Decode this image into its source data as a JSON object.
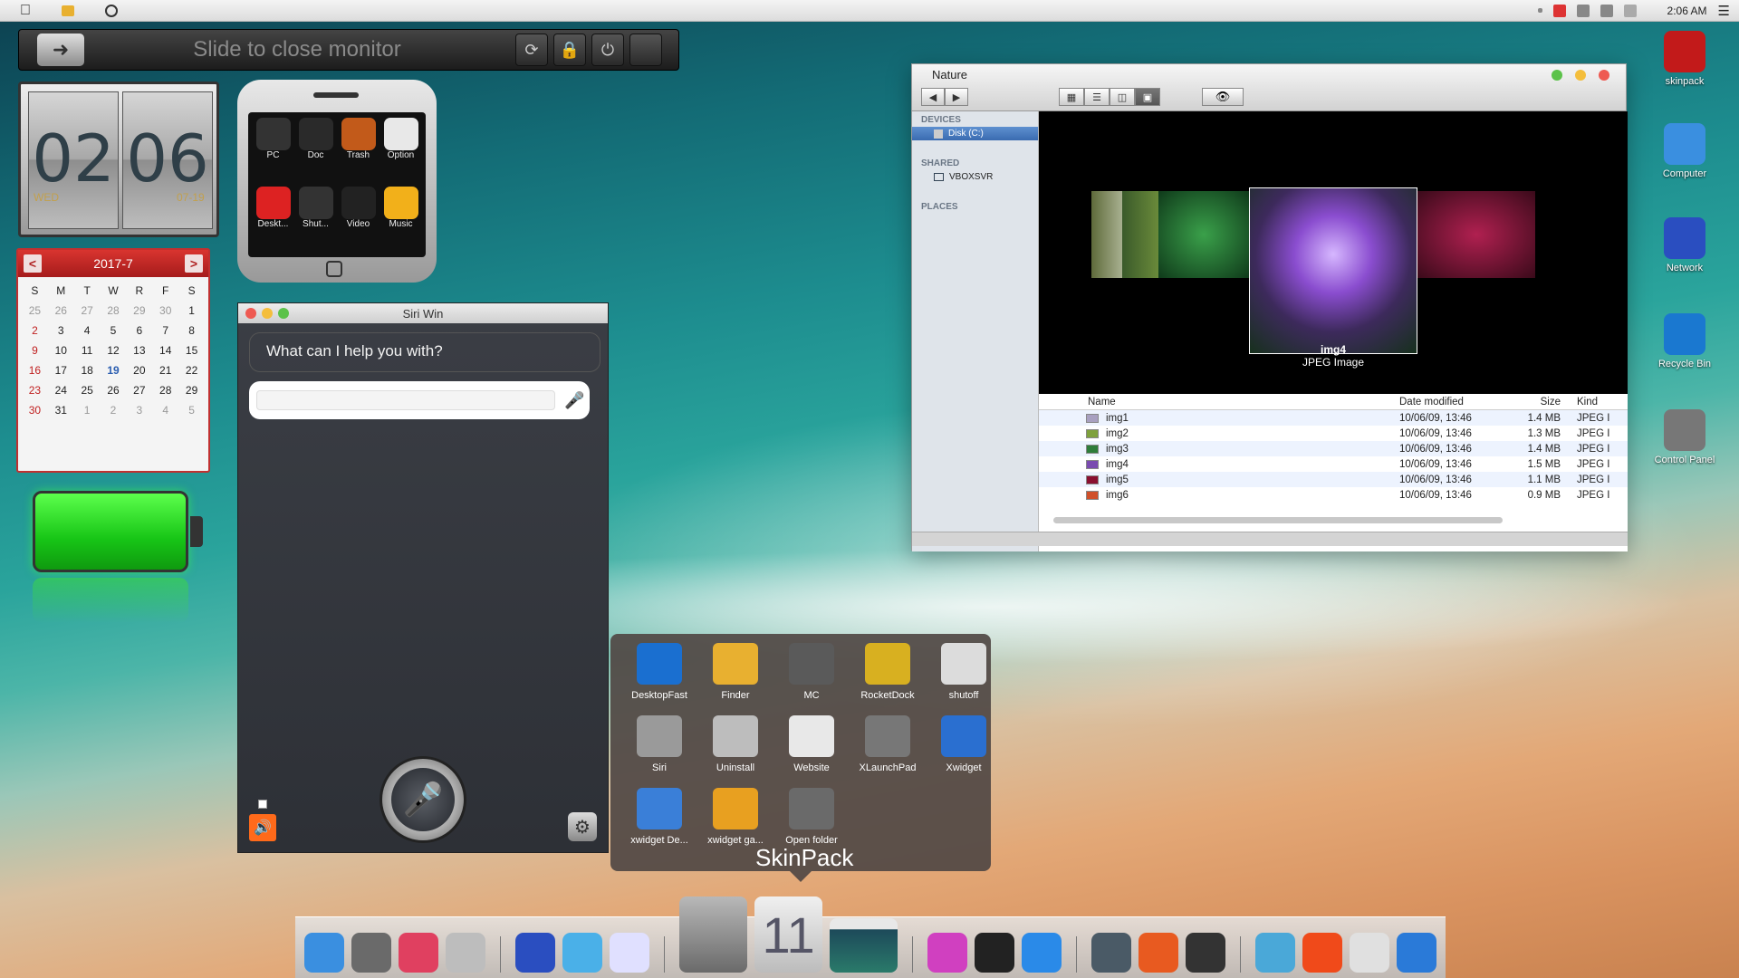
{
  "menubar": {
    "time": "2:06 AM"
  },
  "monitor": {
    "slide_text": "Slide to close monitor"
  },
  "clock": {
    "hour": "02",
    "minute": "06",
    "day": "WED",
    "date": "07-19"
  },
  "calendar": {
    "title": "2017-7",
    "weekdays": [
      "S",
      "M",
      "T",
      "W",
      "R",
      "F",
      "S"
    ],
    "weeks": [
      [
        "25",
        "26",
        "27",
        "28",
        "29",
        "30",
        "1"
      ],
      [
        "2",
        "3",
        "4",
        "5",
        "6",
        "7",
        "8"
      ],
      [
        "9",
        "10",
        "11",
        "12",
        "13",
        "14",
        "15"
      ],
      [
        "16",
        "17",
        "18",
        "19",
        "20",
        "21",
        "22"
      ],
      [
        "23",
        "24",
        "25",
        "26",
        "27",
        "28",
        "29"
      ],
      [
        "30",
        "31",
        "1",
        "2",
        "3",
        "4",
        "5"
      ]
    ]
  },
  "phone": {
    "apps": [
      {
        "label": "PC",
        "color": "#333"
      },
      {
        "label": "Doc",
        "color": "#2a2a2a"
      },
      {
        "label": "Trash",
        "color": "#c25a1a"
      },
      {
        "label": "Option",
        "color": "#e8e8e8"
      },
      {
        "label": "Deskt...",
        "color": "#d22"
      },
      {
        "label": "Shut...",
        "color": "#333"
      },
      {
        "label": "Video",
        "color": "#222"
      },
      {
        "label": "Music",
        "color": "#f2b01a"
      }
    ]
  },
  "siri": {
    "title": "Siri Win",
    "prompt": "What can I help you with?"
  },
  "finder": {
    "title": "Nature",
    "sidebar": {
      "devices_header": "DEVICES",
      "disk": "Disk (C:)",
      "shared_header": "SHARED",
      "shared_item": "VBOXSVR",
      "places_header": "PLACES"
    },
    "preview": {
      "name": "img4",
      "kind": "JPEG Image"
    },
    "columns": {
      "name": "Name",
      "date": "Date modified",
      "size": "Size",
      "kind": "Kind"
    },
    "files": [
      {
        "name": "img1",
        "date": "10/06/09, 13:46",
        "size": "1.4 MB",
        "kind": "JPEG I",
        "color": "#a8a0c0"
      },
      {
        "name": "img2",
        "date": "10/06/09, 13:46",
        "size": "1.3 MB",
        "kind": "JPEG I",
        "color": "#7fa13c"
      },
      {
        "name": "img3",
        "date": "10/06/09, 13:46",
        "size": "1.4 MB",
        "kind": "JPEG I",
        "color": "#2f7d3a"
      },
      {
        "name": "img4",
        "date": "10/06/09, 13:46",
        "size": "1.5 MB",
        "kind": "JPEG I",
        "color": "#7a4bb0"
      },
      {
        "name": "img5",
        "date": "10/06/09, 13:46",
        "size": "1.1 MB",
        "kind": "JPEG I",
        "color": "#8a1030"
      },
      {
        "name": "img6",
        "date": "10/06/09, 13:46",
        "size": "0.9 MB",
        "kind": "JPEG I",
        "color": "#d0502a"
      }
    ]
  },
  "desktop_icons": [
    {
      "label": "skinpack",
      "color": "#c21a1a"
    },
    {
      "label": "Computer",
      "color": "#3a8fe0"
    },
    {
      "label": "Network",
      "color": "#2a4ec0"
    },
    {
      "label": "Recycle Bin",
      "color": "#1a78d0"
    },
    {
      "label": "Control Panel",
      "color": "#777"
    }
  ],
  "launcher": {
    "brand": "SkinPack",
    "items": [
      {
        "label": "DesktopFast",
        "color": "#1a6fd0"
      },
      {
        "label": "Finder",
        "color": "#e8b030"
      },
      {
        "label": "MC",
        "color": "#5a5a5a"
      },
      {
        "label": "RocketDock",
        "color": "#d8b020"
      },
      {
        "label": "shutoff",
        "color": "#dcdcdc"
      },
      {
        "label": "Siri",
        "color": "#9a9a9a"
      },
      {
        "label": "Uninstall",
        "color": "#bdbdbd"
      },
      {
        "label": "Website",
        "color": "#e8e8e8"
      },
      {
        "label": "XLaunchPad",
        "color": "#777"
      },
      {
        "label": "Xwidget",
        "color": "#2a6fd0"
      },
      {
        "label": "xwidget De...",
        "color": "#3a7fd8"
      },
      {
        "label": "xwidget ga...",
        "color": "#e8a020"
      },
      {
        "label": "Open folder",
        "color": "#6a6a6a"
      }
    ]
  },
  "dock": {
    "left": [
      {
        "name": "finder-icon",
        "color": "#3a8fe0"
      },
      {
        "name": "settings-icon",
        "color": "#6a6a6a"
      },
      {
        "name": "colors-icon",
        "color": "#e04060"
      },
      {
        "name": "siri-icon",
        "color": "#bdbdbd"
      }
    ],
    "mid": [
      {
        "name": "globe-icon",
        "color": "#2a4ec0"
      },
      {
        "name": "clapper-icon",
        "color": "#4ab0e8"
      },
      {
        "name": "pen-icon",
        "color": "#e0e0ff"
      }
    ],
    "right1": [
      {
        "name": "music-icon",
        "color": "#d040c0"
      },
      {
        "name": "cloud-icon",
        "color": "#222"
      },
      {
        "name": "appstore-icon",
        "color": "#2a8ae8"
      }
    ],
    "right2": [
      {
        "name": "database-icon",
        "color": "#4a5a66"
      },
      {
        "name": "rocket-icon",
        "color": "#e85a20"
      },
      {
        "name": "dashboard-icon",
        "color": "#333"
      }
    ],
    "right3": [
      {
        "name": "info-icon",
        "color": "#4aa8d8"
      },
      {
        "name": "power-icon",
        "color": "#f04a1a"
      },
      {
        "name": "appstore-a-icon",
        "color": "#e0e0e0"
      },
      {
        "name": "book-icon",
        "color": "#2a7ad8"
      }
    ],
    "big_label": "11"
  }
}
